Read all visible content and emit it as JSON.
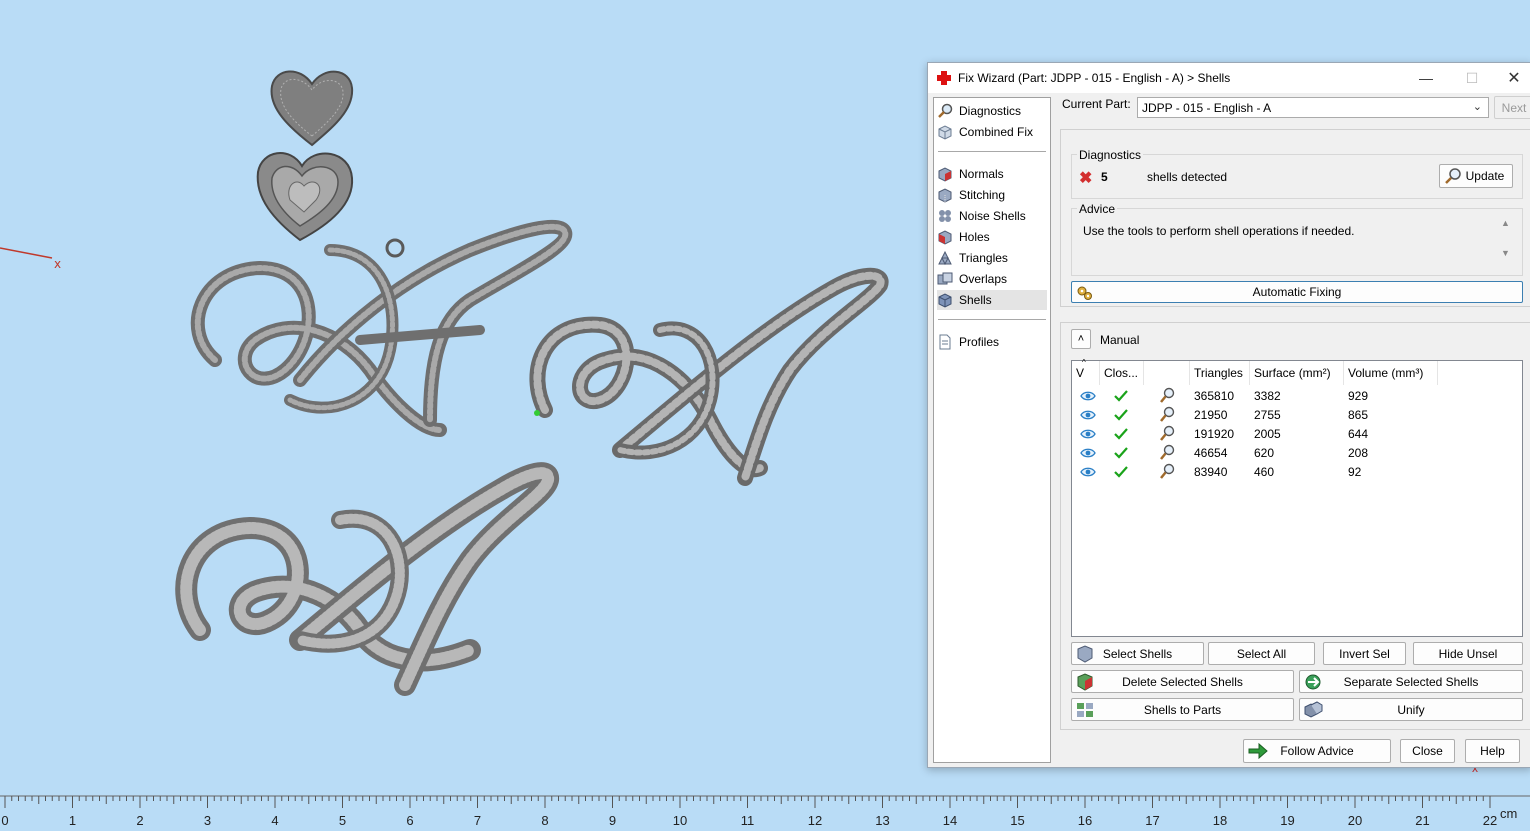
{
  "viewport": {
    "axis_x_label": "x",
    "corner_marker": "x",
    "ruler": {
      "numbers": [
        "0",
        "1",
        "2",
        "3",
        "4",
        "5",
        "6",
        "7",
        "8",
        "9",
        "10",
        "11",
        "12",
        "13",
        "14",
        "15",
        "16",
        "17",
        "18",
        "19",
        "20",
        "21",
        "22"
      ],
      "unit": "cm"
    }
  },
  "dialog": {
    "title": "Fix Wizard (Part: JDPP - 015 - English - A) > Shells",
    "nav": {
      "group1": [
        {
          "label": "Diagnostics",
          "icon": "magnifier-icon"
        },
        {
          "label": "Combined Fix",
          "icon": "cube-icon"
        }
      ],
      "group2": [
        {
          "label": "Normals",
          "icon": "normals-cube-icon"
        },
        {
          "label": "Stitching",
          "icon": "stitching-cube-icon"
        },
        {
          "label": "Noise Shells",
          "icon": "noise-shells-icon"
        },
        {
          "label": "Holes",
          "icon": "holes-cube-icon"
        },
        {
          "label": "Triangles",
          "icon": "triangles-icon"
        },
        {
          "label": "Overlaps",
          "icon": "overlaps-icon"
        },
        {
          "label": "Shells",
          "icon": "shells-cube-icon",
          "selected": true
        }
      ],
      "group3": [
        {
          "label": "Profiles",
          "icon": "document-icon"
        }
      ]
    },
    "current_part_label": "Current Part:",
    "current_part_value": "JDPP - 015 - English - A",
    "next_label": "Next",
    "diagnostics": {
      "title": "Diagnostics",
      "count": "5",
      "message": "shells detected",
      "update_label": "Update"
    },
    "advice": {
      "title": "Advice",
      "text": "Use the tools to perform shell operations if needed."
    },
    "automatic_fixing_label": "Automatic Fixing",
    "manual_label": "Manual",
    "table": {
      "headers": [
        "V",
        "Clos...",
        "",
        "Triangles",
        "Surface (mm²)",
        "Volume (mm³)"
      ],
      "rows": [
        {
          "triangles": "365810",
          "surface": "3382",
          "volume": "929"
        },
        {
          "triangles": "21950",
          "surface": "2755",
          "volume": "865"
        },
        {
          "triangles": "191920",
          "surface": "2005",
          "volume": "644"
        },
        {
          "triangles": "46654",
          "surface": "620",
          "volume": "208"
        },
        {
          "triangles": "83940",
          "surface": "460",
          "volume": "92"
        }
      ]
    },
    "buttons": {
      "select_shells": "Select Shells",
      "select_all": "Select All",
      "invert_sel": "Invert Sel",
      "hide_unsel": "Hide Unsel",
      "delete_selected": "Delete Selected Shells",
      "separate_selected": "Separate Selected Shells",
      "shells_to_parts": "Shells to Parts",
      "unify": "Unify",
      "follow_advice": "Follow Advice",
      "close": "Close",
      "help": "Help"
    }
  },
  "colors": {
    "background": "#b9dcf6",
    "model": "#8c8c8c",
    "axis": "#c0392b",
    "check": "#1aa31a",
    "error": "#d32f2f"
  }
}
